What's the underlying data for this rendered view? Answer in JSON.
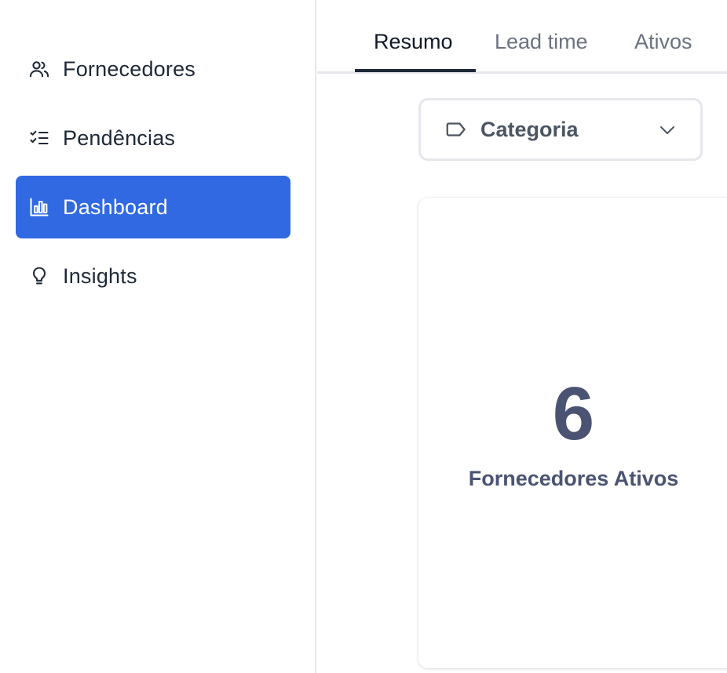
{
  "sidebar": {
    "items": [
      {
        "label": "Fornecedores",
        "icon": "users-icon",
        "active": false
      },
      {
        "label": "Pendências",
        "icon": "checklist-icon",
        "active": false
      },
      {
        "label": "Dashboard",
        "icon": "bar-chart-icon",
        "active": true
      },
      {
        "label": "Insights",
        "icon": "lightbulb-icon",
        "active": false
      }
    ]
  },
  "tabs": [
    {
      "label": "Resumo",
      "active": true
    },
    {
      "label": "Lead time",
      "active": false
    },
    {
      "label": "Ativos",
      "active": false
    }
  ],
  "filter": {
    "label": "Categoria",
    "icon": "tag-icon"
  },
  "metric": {
    "value": "6",
    "label": "Fornecedores Ativos"
  },
  "colors": {
    "accent": "#3169e3",
    "metric_text": "#4a5472",
    "border": "#e5e7eb"
  }
}
